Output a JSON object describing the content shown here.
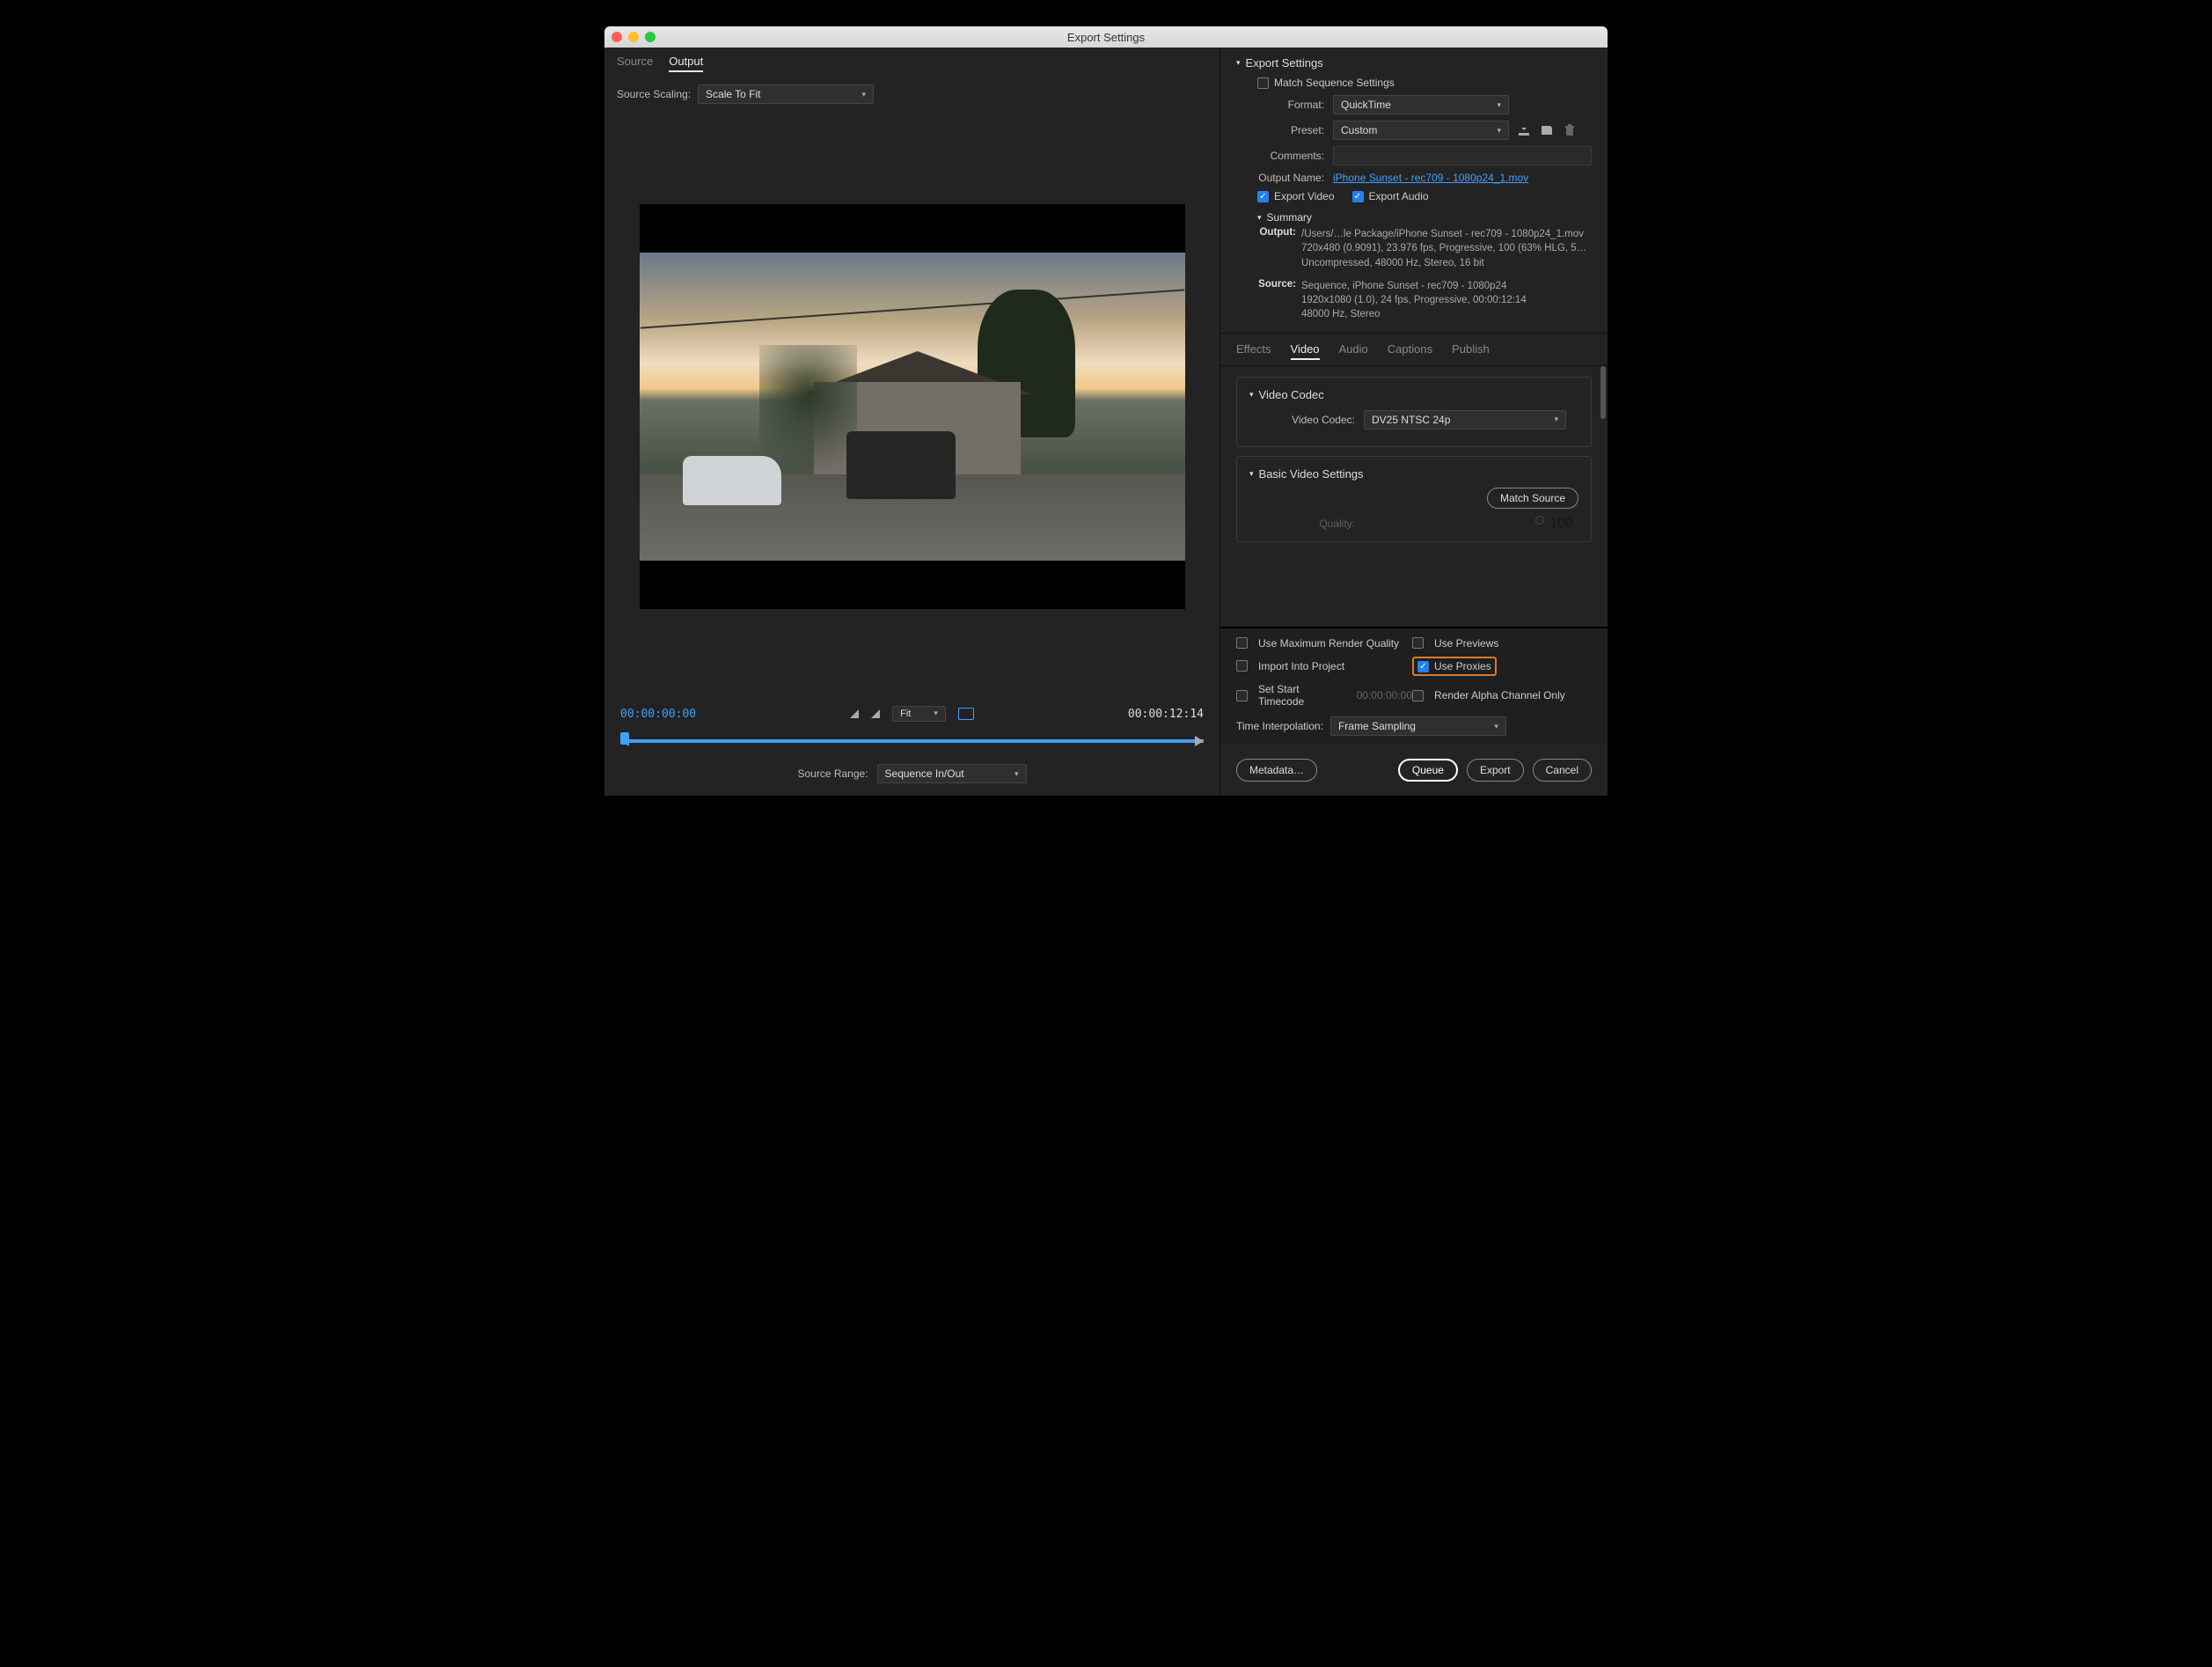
{
  "window": {
    "title": "Export Settings"
  },
  "left": {
    "tabs": {
      "source": "Source",
      "output": "Output"
    },
    "scaling_label": "Source Scaling:",
    "scaling_value": "Scale To Fit",
    "tc_in": "00:00:00:00",
    "tc_out": "00:00:12:14",
    "fit": "Fit",
    "source_range_label": "Source Range:",
    "source_range_value": "Sequence In/Out"
  },
  "export": {
    "header": "Export Settings",
    "match_seq": "Match Sequence Settings",
    "format_label": "Format:",
    "format_value": "QuickTime",
    "preset_label": "Preset:",
    "preset_value": "Custom",
    "comments_label": "Comments:",
    "output_name_label": "Output Name:",
    "output_name_value": "iPhone Sunset - rec709 - 1080p24_1.mov",
    "export_video": "Export Video",
    "export_audio": "Export Audio",
    "summary_label": "Summary",
    "summary_output_key": "Output:",
    "summary_output_val": "/Users/…le Package/iPhone Sunset - rec709 - 1080p24_1.mov\n720x480 (0.9091), 23.976 fps, Progressive, 100 (63% HLG, 5…\nUncompressed, 48000 Hz, Stereo, 16 bit",
    "summary_source_key": "Source:",
    "summary_source_val": "Sequence, iPhone Sunset - rec709 - 1080p24\n1920x1080 (1.0), 24 fps, Progressive, 00:00:12:14\n48000 Hz, Stereo"
  },
  "tabs2": {
    "effects": "Effects",
    "video": "Video",
    "audio": "Audio",
    "captions": "Captions",
    "publish": "Publish"
  },
  "video": {
    "codec_header": "Video Codec",
    "codec_label": "Video Codec:",
    "codec_value": "DV25 NTSC 24p",
    "basic_header": "Basic Video Settings",
    "match_source": "Match Source",
    "quality_label": "Quality:",
    "quality_value": "100"
  },
  "footer": {
    "max_quality": "Use Maximum Render Quality",
    "use_previews": "Use Previews",
    "import_project": "Import Into Project",
    "use_proxies": "Use Proxies",
    "set_start_tc": "Set Start Timecode",
    "start_tc_value": "00:00:00:00",
    "render_alpha": "Render Alpha Channel Only",
    "time_interp_label": "Time Interpolation:",
    "time_interp_value": "Frame Sampling",
    "metadata": "Metadata…",
    "queue": "Queue",
    "export": "Export",
    "cancel": "Cancel"
  }
}
